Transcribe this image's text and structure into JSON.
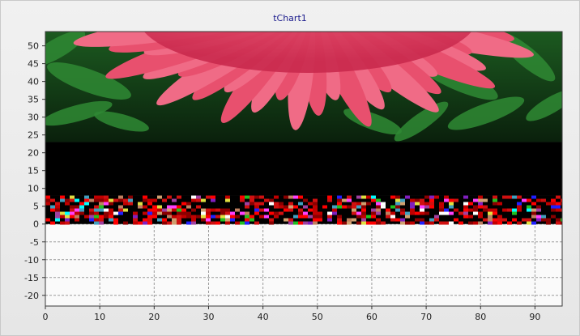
{
  "chart_data": {
    "type": "heatmap",
    "title": "tChart1",
    "xlabel": "",
    "ylabel": "",
    "xlim": [
      0,
      95
    ],
    "ylim": [
      -23,
      54
    ],
    "x_ticks": [
      0,
      10,
      20,
      30,
      40,
      50,
      60,
      70,
      80,
      90
    ],
    "y_ticks": [
      50,
      45,
      40,
      35,
      30,
      25,
      20,
      15,
      10,
      5,
      0,
      -5,
      -10,
      -15,
      -20
    ],
    "grid": true,
    "legend": "none",
    "image_bands": [
      {
        "name": "photo",
        "y_range": [
          23,
          54
        ],
        "content": "red flower petals over green foliage"
      },
      {
        "name": "black",
        "y_range": [
          8,
          23
        ],
        "color": "#000000"
      },
      {
        "name": "noise",
        "y_range": [
          0,
          8
        ],
        "content": "multicolored pixel noise on black"
      }
    ],
    "colors": {
      "petal": "#e84a6a",
      "petal_light": "#f27a92",
      "leaf": "#2f8a34",
      "leaf_dark": "#0f3a12",
      "black": "#000000",
      "plot_bg": "#fafafa",
      "grid": "#9a9a9a",
      "title": "#1a1a8c"
    }
  }
}
